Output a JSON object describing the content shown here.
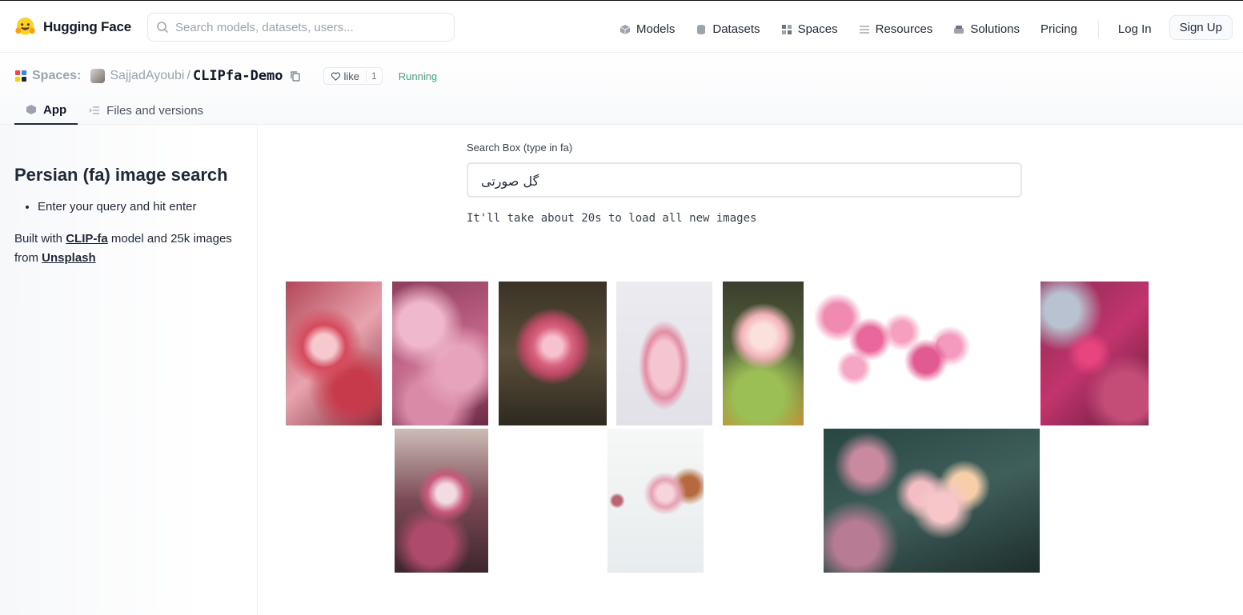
{
  "nav": {
    "brand": "Hugging Face",
    "search_placeholder": "Search models, datasets, users...",
    "links": [
      {
        "label": "Models",
        "icon": "cube-icon"
      },
      {
        "label": "Datasets",
        "icon": "database-icon"
      },
      {
        "label": "Spaces",
        "icon": "grid-icon"
      },
      {
        "label": "Resources",
        "icon": "list-icon"
      },
      {
        "label": "Solutions",
        "icon": "stack-icon"
      },
      {
        "label": "Pricing"
      }
    ],
    "login": "Log In",
    "signup": "Sign Up"
  },
  "space": {
    "section": "Spaces:",
    "owner": "SajjadAyoubi",
    "separator": "/",
    "name": "CLIPfa-Demo",
    "like_label": "like",
    "like_count": "1",
    "status": "Running",
    "tabs": [
      {
        "label": "App",
        "active": true
      },
      {
        "label": "Files and versions",
        "active": false
      }
    ]
  },
  "sidebar": {
    "title": "Persian (fa) image search",
    "bullet": "Enter your query and hit enter",
    "built_prefix": "Built with ",
    "model_link": "CLIP-fa",
    "built_middle": " model and 25k images from ",
    "source_link": "Unsplash"
  },
  "main": {
    "search_label": "Search Box (type in fa)",
    "query": "گل صورتی",
    "load_message": "It'll take about 20s to load all new images"
  },
  "colors": {
    "status_running": "#34b079",
    "brand_yellow": "#ffd21e"
  }
}
